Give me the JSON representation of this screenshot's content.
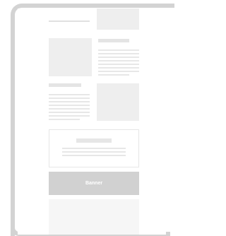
{
  "banner": {
    "label": "Banner"
  }
}
